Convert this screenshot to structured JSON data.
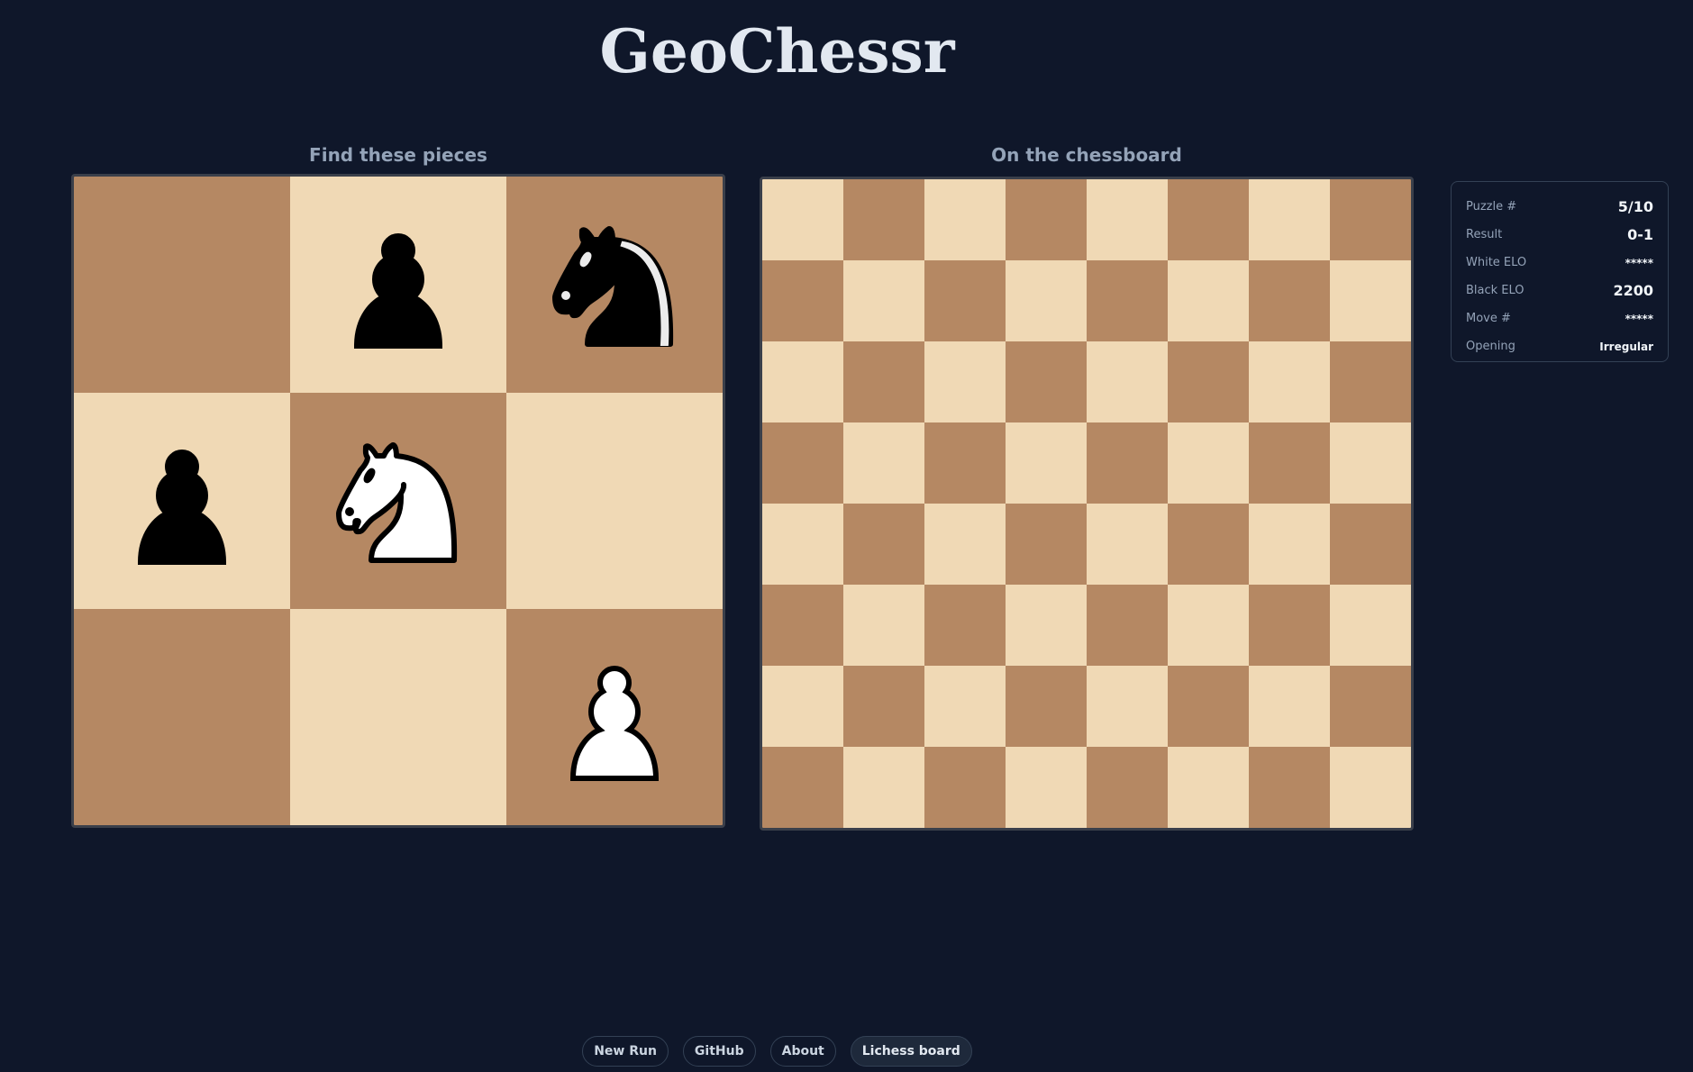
{
  "app": {
    "title": "GeoChessr"
  },
  "left_panel": {
    "heading": "Find these pieces",
    "squares": [
      {
        "color": "dark",
        "piece": ""
      },
      {
        "color": "light",
        "piece": "black-pawn"
      },
      {
        "color": "dark",
        "piece": "black-knight"
      },
      {
        "color": "light",
        "piece": "black-pawn"
      },
      {
        "color": "dark",
        "piece": "white-knight"
      },
      {
        "color": "light",
        "piece": ""
      },
      {
        "color": "dark",
        "piece": ""
      },
      {
        "color": "light",
        "piece": ""
      },
      {
        "color": "dark",
        "piece": "white-pawn"
      }
    ]
  },
  "right_panel": {
    "heading": "On the chessboard",
    "files": 8,
    "ranks": 8
  },
  "colors": {
    "light_square": "#f0d9b5",
    "dark_square": "#b58863",
    "background": "#0f172a"
  },
  "info": {
    "rows": [
      {
        "label": "Puzzle #",
        "value": "5/10"
      },
      {
        "label": "Result",
        "value": "0-1"
      },
      {
        "label": "White ELO",
        "value": "*****"
      },
      {
        "label": "Black ELO",
        "value": "2200"
      },
      {
        "label": "Move #",
        "value": "*****"
      },
      {
        "label": "Opening",
        "value": "Irregular"
      }
    ]
  },
  "footer": {
    "buttons": [
      {
        "label": "New Run"
      },
      {
        "label": "GitHub"
      },
      {
        "label": "About"
      },
      {
        "label": "Lichess board"
      }
    ]
  }
}
